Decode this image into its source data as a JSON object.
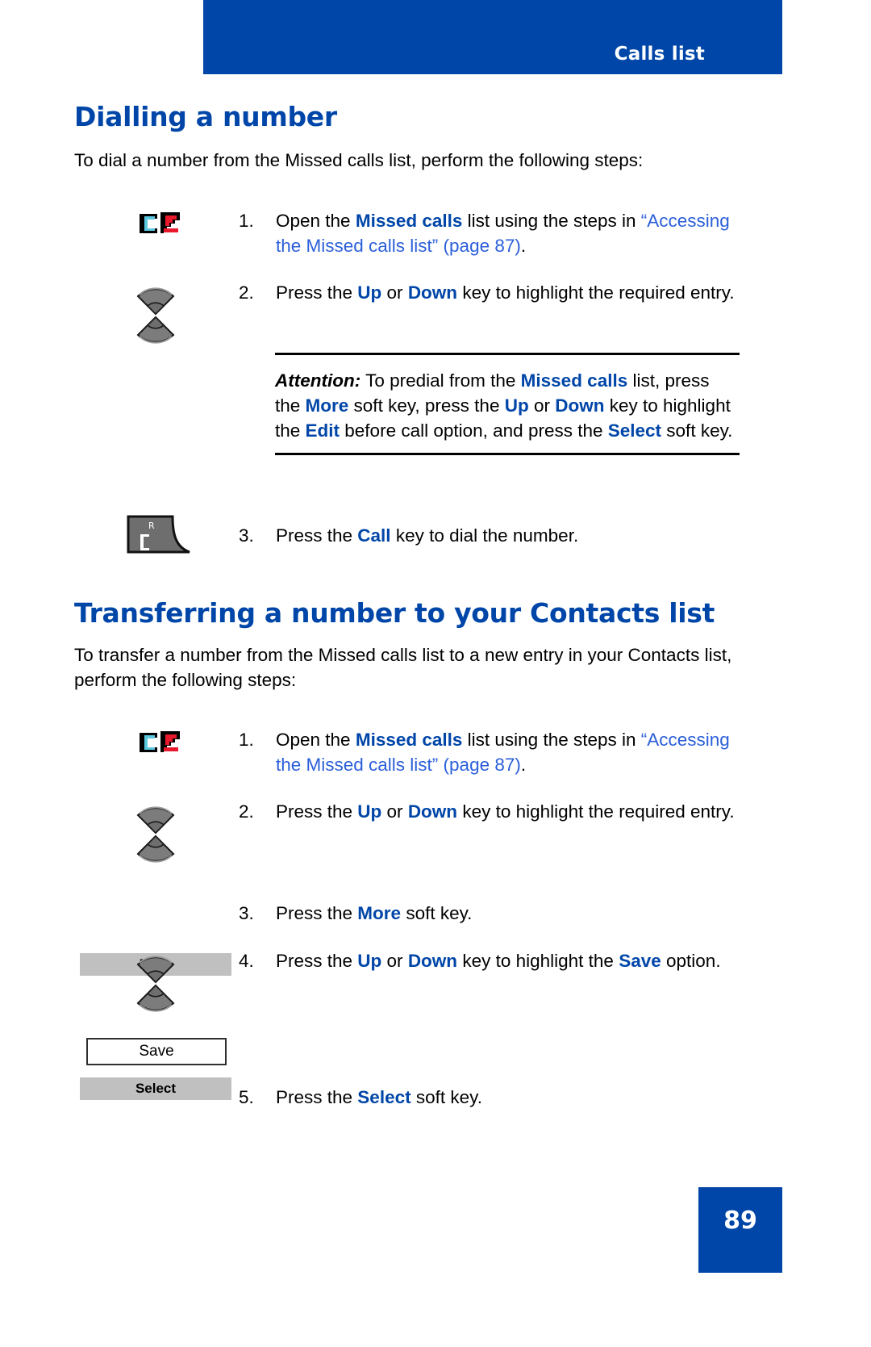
{
  "header": {
    "title": "Calls list",
    "band_color": "#0046a8"
  },
  "sections": [
    {
      "heading": "Dialling a number",
      "intro": "To dial a number from the Missed calls list, perform the following steps:",
      "steps": [
        {
          "number": "1.",
          "icon": "missed-calls-icon",
          "text_before": "Open the ",
          "keyword1": "Missed calls",
          "text_mid": " list using the steps in ",
          "xref": "“Accessing the Missed calls list” (page 87)",
          "text_after": "."
        },
        {
          "number": "2.",
          "icon": "navigation-up-down-key-icon",
          "text_before": "Press the ",
          "keyword1": "Up",
          "text_mid": " or ",
          "keyword2": "Down",
          "text_after": " key to highlight the required entry."
        },
        {
          "number": "3.",
          "icon": "call-key-icon",
          "text_before": "Press the ",
          "keyword1": "Call",
          "text_after": " key to dial the number."
        }
      ],
      "attention": {
        "lead": "Attention:",
        "p1": " To predial from the ",
        "kw1": "Missed calls",
        "p2": " list, press the ",
        "kw2": "More",
        "p3": " soft key, press the ",
        "kw3": "Up",
        "p4": " or ",
        "kw4": "Down",
        "p5": " key to highlight the ",
        "kw5": "Edit",
        "p6": " before call option, and press the ",
        "kw6": "Select",
        "p7": " soft key."
      }
    },
    {
      "heading": "Transferring a number to your Contacts list",
      "intro": "To transfer a number from the Missed calls list to a new entry in your Contacts list, perform the following steps:",
      "steps": [
        {
          "number": "1.",
          "icon": "missed-calls-icon",
          "text_before": "Open the ",
          "keyword1": "Missed calls",
          "text_mid": " list using the steps in ",
          "xref": "“Accessing the Missed calls list” (page 87)",
          "text_after": "."
        },
        {
          "number": "2.",
          "icon": "navigation-up-down-key-icon",
          "text_before": "Press the ",
          "keyword1": "Up",
          "text_mid": " or ",
          "keyword2": "Down",
          "text_after": " key to highlight the required entry."
        },
        {
          "number": "3.",
          "icon": "softkey-more",
          "text_before": "Press the ",
          "keyword1": "More",
          "text_after": " soft key."
        },
        {
          "number": "4.",
          "icon": "navigation-up-down-key-icon",
          "text_before": "Press the ",
          "keyword1": "Up",
          "text_mid": " or ",
          "keyword2": "Down",
          "text_mid2": " key to highlight the ",
          "keyword3": "Save",
          "text_after": " option."
        },
        {
          "number": "5.",
          "icon": "softkey-select",
          "text_before": "Press the ",
          "keyword1": "Select",
          "text_after": " soft key."
        }
      ]
    }
  ],
  "softkeys": {
    "more": "More",
    "select": "Select"
  },
  "option_boxes": {
    "save": "Save"
  },
  "footer": {
    "page_number": "89"
  },
  "colors": {
    "brand_blue": "#0046a8",
    "link_blue": "#2b5fd9",
    "softkey_gray": "#c0c0c0"
  }
}
